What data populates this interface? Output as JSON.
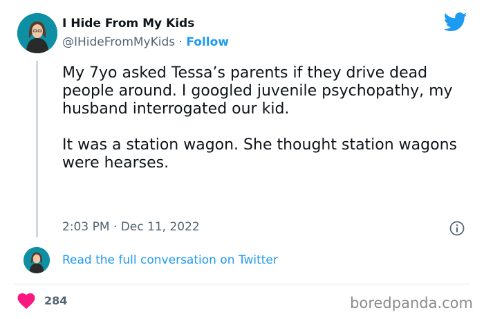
{
  "author": {
    "display_name": "I Hide From My Kids",
    "handle": "@IHideFromMyKids",
    "separator": " · ",
    "follow_label": "Follow"
  },
  "tweet": {
    "paragraphs": [
      "My 7yo asked Tessa’s parents if they drive dead people around. I googled juvenile psychopathy, my husband interrogated our kid.",
      "It was a station wagon. She thought station wagons were hearses."
    ],
    "timestamp": "2:03 PM · Dec 11, 2022"
  },
  "conversation_link": "Read the full conversation on Twitter",
  "likes": "284",
  "watermark": "boredpanda.com",
  "icons": {
    "brand": "twitter-bird-icon",
    "info": "info-icon",
    "like": "heart-icon"
  },
  "colors": {
    "link_blue": "#1d9bf0",
    "heart_red": "#f91880",
    "secondary_text": "#536471",
    "avatar_bg": "#0e8fa3"
  }
}
